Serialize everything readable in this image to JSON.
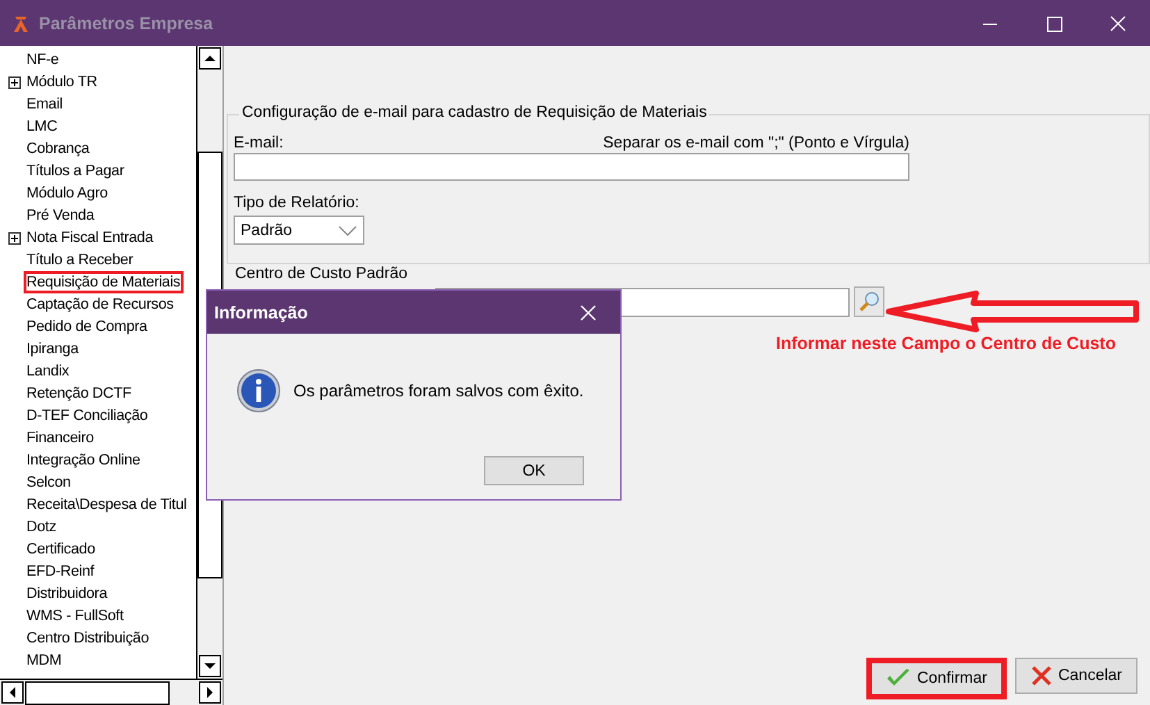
{
  "window": {
    "title": "Parâmetros Empresa"
  },
  "tree": {
    "items": [
      {
        "label": "NF-e",
        "kind": "leaf",
        "annotated": false
      },
      {
        "label": "Módulo TR",
        "kind": "folder",
        "annotated": false
      },
      {
        "label": "Email",
        "kind": "leaf",
        "annotated": false
      },
      {
        "label": "LMC",
        "kind": "leaf",
        "annotated": false
      },
      {
        "label": "Cobrança",
        "kind": "leaf",
        "annotated": false
      },
      {
        "label": "Títulos a Pagar",
        "kind": "leaf",
        "annotated": false
      },
      {
        "label": "Módulo Agro",
        "kind": "leaf",
        "annotated": false
      },
      {
        "label": "Pré Venda",
        "kind": "leaf",
        "annotated": false
      },
      {
        "label": "Nota Fiscal Entrada",
        "kind": "folder",
        "annotated": false
      },
      {
        "label": "Título a Receber",
        "kind": "leaf",
        "annotated": false
      },
      {
        "label": "Requisição de Materiais",
        "kind": "leaf",
        "annotated": true
      },
      {
        "label": "Captação de Recursos",
        "kind": "leaf",
        "annotated": false
      },
      {
        "label": "Pedido de Compra",
        "kind": "leaf",
        "annotated": false
      },
      {
        "label": "Ipiranga",
        "kind": "leaf",
        "annotated": false
      },
      {
        "label": "Landix",
        "kind": "leaf",
        "annotated": false
      },
      {
        "label": "Retenção DCTF",
        "kind": "leaf",
        "annotated": false
      },
      {
        "label": "D-TEF Conciliação",
        "kind": "leaf",
        "annotated": false
      },
      {
        "label": "Financeiro",
        "kind": "leaf",
        "annotated": false
      },
      {
        "label": "Integração Online",
        "kind": "leaf",
        "annotated": false
      },
      {
        "label": "Selcon",
        "kind": "leaf",
        "annotated": false
      },
      {
        "label": "Receita\\Despesa de Titul",
        "kind": "leaf",
        "annotated": false
      },
      {
        "label": "Dotz",
        "kind": "leaf",
        "annotated": false
      },
      {
        "label": "Certificado",
        "kind": "leaf",
        "annotated": false
      },
      {
        "label": "EFD-Reinf",
        "kind": "leaf",
        "annotated": false
      },
      {
        "label": "Distribuidora",
        "kind": "leaf",
        "annotated": false
      },
      {
        "label": "WMS - FullSoft",
        "kind": "leaf",
        "annotated": false
      },
      {
        "label": "Centro Distribuição",
        "kind": "leaf",
        "annotated": false
      },
      {
        "label": "MDM",
        "kind": "leaf",
        "annotated": false
      }
    ]
  },
  "email_group": {
    "legend": "Configuração de e-mail para cadastro de Requisição de Materiais",
    "email_label": "E-mail:",
    "email_hint": "Separar os e-mail com \";\" (Ponto e Vírgula)",
    "report_label": "Tipo de Relatório:",
    "report_value": "Padrão"
  },
  "cost_center": {
    "label": "Centro de Custo Padrão"
  },
  "annotation": {
    "text": "Informar neste Campo o Centro de Custo"
  },
  "buttons": [
    {
      "kind": "confirm",
      "label": "Confirmar",
      "annotated": true
    },
    {
      "kind": "cancel",
      "label": "Cancelar",
      "annotated": false
    }
  ],
  "dialog": {
    "title": "Informação",
    "message": "Os parâmetros foram salvos com êxito.",
    "button": "OK"
  }
}
